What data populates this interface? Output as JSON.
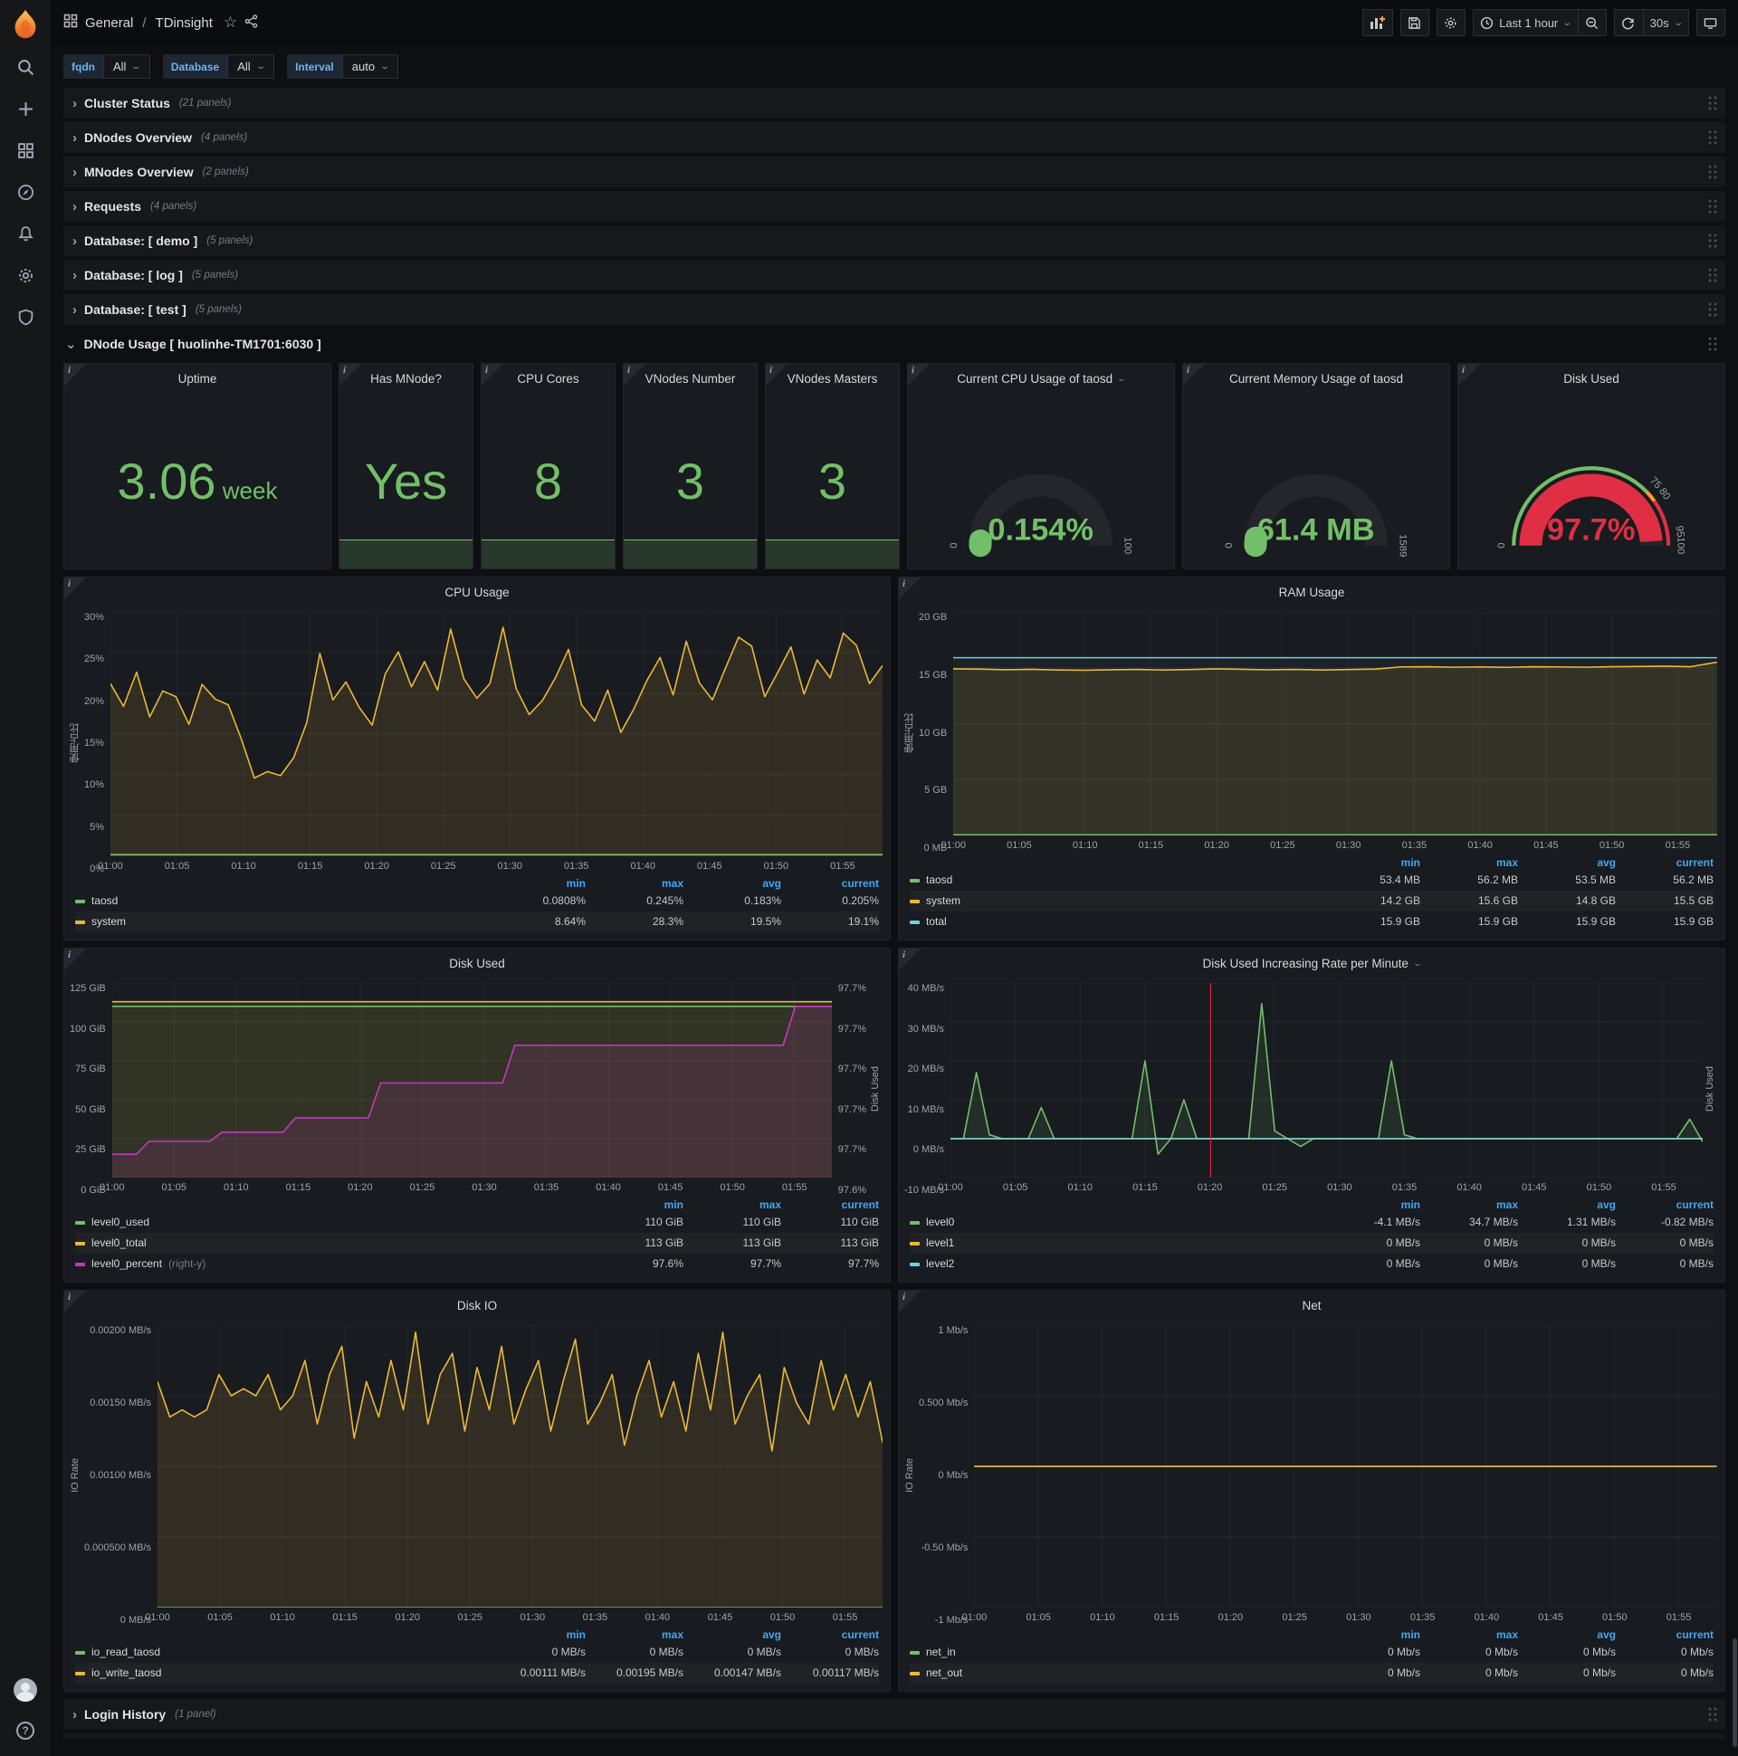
{
  "header": {
    "section": "General",
    "separator": "/",
    "title": "TDinsight"
  },
  "toolbar": {
    "time_range": "Last 1 hour",
    "refresh": "30s"
  },
  "variables": [
    {
      "label": "fqdn",
      "value": "All"
    },
    {
      "label": "Database",
      "value": "All"
    },
    {
      "label": "Interval",
      "value": "auto"
    }
  ],
  "collapsed_rows": [
    {
      "title": "Cluster Status",
      "count": "(21 panels)"
    },
    {
      "title": "DNodes Overview",
      "count": "(4 panels)"
    },
    {
      "title": "MNodes Overview",
      "count": "(2 panels)"
    },
    {
      "title": "Requests",
      "count": "(4 panels)"
    },
    {
      "title": "Database: [ demo ]",
      "count": "(5 panels)"
    },
    {
      "title": "Database: [ log ]",
      "count": "(5 panels)"
    },
    {
      "title": "Database: [ test ]",
      "count": "(5 panels)"
    }
  ],
  "expanded_row": {
    "title": "DNode Usage [ huolinhe-TM1701:6030 ]"
  },
  "login_row": {
    "title": "Login History",
    "count": "(1 panel)"
  },
  "stats": [
    {
      "title": "Uptime",
      "value": "3.06",
      "suffix": " week",
      "sparkline": false,
      "width": 2
    },
    {
      "title": "Has MNode?",
      "value": "Yes",
      "suffix": "",
      "sparkline": true,
      "width": 1
    },
    {
      "title": "CPU Cores",
      "value": "8",
      "suffix": "",
      "sparkline": true,
      "width": 1
    },
    {
      "title": "VNodes Number",
      "value": "3",
      "suffix": "",
      "sparkline": true,
      "width": 1
    },
    {
      "title": "VNodes Masters",
      "value": "3",
      "suffix": "",
      "sparkline": true,
      "width": 1
    }
  ],
  "gauges": [
    {
      "title": "Current CPU Usage of taosd",
      "dropdown": true,
      "value": "0.154%",
      "value_color": "#73bf69",
      "frac": 0.025,
      "arc_color": "#73bf69",
      "ticks": [
        {
          "f": 0,
          "label": "0"
        },
        {
          "f": 1,
          "label": "100"
        }
      ]
    },
    {
      "title": "Current Memory Usage of taosd",
      "dropdown": false,
      "value": "61.4 MB",
      "value_color": "#73bf69",
      "frac": 0.04,
      "arc_color": "#73bf69",
      "ticks": [
        {
          "f": 0,
          "label": "0"
        },
        {
          "f": 1,
          "label": "1589"
        }
      ]
    },
    {
      "title": "Disk Used",
      "dropdown": false,
      "value": "97.7%",
      "value_color": "#e02f44",
      "frac": 0.977,
      "arc_color": "#e02f44",
      "ticks": [
        {
          "f": 0,
          "label": "0"
        },
        {
          "f": 0.755,
          "label": "75"
        },
        {
          "f": 0.805,
          "label": "80"
        },
        {
          "f": 0.95,
          "label": "95"
        },
        {
          "f": 1,
          "label": "100"
        }
      ],
      "thresholds": [
        {
          "from": 0,
          "to": 0.755,
          "color": "#73bf69"
        },
        {
          "from": 0.755,
          "to": 0.805,
          "color": "#ff9830"
        },
        {
          "from": 0.805,
          "to": 1,
          "color": "#e02f44"
        }
      ]
    }
  ],
  "chart_data": [
    {
      "type": "line",
      "title": "CPU Usage",
      "dropdown": false,
      "ylabel": "使用占比",
      "right_label": null,
      "ylim": [
        0,
        30
      ],
      "y_ticks": [
        "0%",
        "5%",
        "10%",
        "15%",
        "20%",
        "25%",
        "30%"
      ],
      "x_ticks": [
        "01:00",
        "01:05",
        "01:10",
        "01:15",
        "01:20",
        "01:25",
        "01:30",
        "01:35",
        "01:40",
        "01:45",
        "01:50",
        "01:55"
      ],
      "x_total_minutes": 58,
      "series": [
        {
          "name": "system",
          "color": "#eab839",
          "fill": 0.12,
          "values": [
            21.2,
            18.4,
            22.6,
            17.1,
            20.3,
            19.6,
            16.2,
            21.1,
            19.3,
            18.6,
            14.4,
            9.6,
            10.4,
            9.9,
            12.1,
            16.4,
            24.9,
            19.2,
            21.4,
            18.3,
            16.1,
            22.4,
            25.1,
            20.8,
            23.9,
            20.4,
            27.9,
            21.8,
            19.4,
            21.2,
            28.1,
            20.6,
            17.4,
            19.1,
            21.9,
            25.4,
            18.6,
            16.6,
            20.4,
            15.2,
            18.1,
            21.6,
            24.4,
            19.8,
            26.4,
            21.3,
            19.2,
            23.1,
            26.9,
            25.8,
            19.6,
            22.6,
            25.7,
            19.9,
            24.1,
            21.9,
            27.4,
            25.9,
            21.2,
            23.4
          ]
        },
        {
          "name": "taosd",
          "color": "#73bf69",
          "fill": 0.1,
          "values": [
            0.2,
            0.2
          ]
        }
      ],
      "legend": {
        "headers": [
          "min",
          "max",
          "avg",
          "current"
        ],
        "rows": [
          {
            "name": "taosd",
            "suffix": "",
            "color": "#73bf69",
            "values": [
              "0.0808%",
              "0.245%",
              "0.183%",
              "0.205%"
            ]
          },
          {
            "name": "system",
            "suffix": "",
            "color": "#eab839",
            "values": [
              "8.64%",
              "28.3%",
              "19.5%",
              "19.1%"
            ]
          }
        ]
      }
    },
    {
      "type": "line",
      "title": "RAM Usage",
      "dropdown": false,
      "ylabel": "使用占比",
      "right_label": null,
      "ylim": [
        0,
        20
      ],
      "y_ticks": [
        "0 MB",
        "5 GB",
        "10 GB",
        "15 GB",
        "20 GB"
      ],
      "x_ticks": [
        "01:00",
        "01:05",
        "01:10",
        "01:15",
        "01:20",
        "01:25",
        "01:30",
        "01:35",
        "01:40",
        "01:45",
        "01:50",
        "01:55"
      ],
      "x_total_minutes": 58,
      "series": [
        {
          "name": "total",
          "color": "#6ed0e0",
          "fill": 0.04,
          "values": [
            15.9,
            15.9
          ]
        },
        {
          "name": "system",
          "color": "#eab839",
          "fill": 0.12,
          "values": [
            14.9,
            14.88,
            14.82,
            14.86,
            14.8,
            14.78,
            14.82,
            14.85,
            14.8,
            14.84,
            14.9,
            14.86,
            14.82,
            14.85,
            14.8,
            14.84,
            14.88,
            15.08,
            15.1,
            15.05,
            15.08,
            15.04,
            15.1,
            15.08,
            15.05,
            15.1,
            15.12,
            15.15,
            15.1,
            15.5
          ]
        },
        {
          "name": "taosd",
          "color": "#73bf69",
          "fill": 0.1,
          "values": [
            0.055,
            0.055
          ]
        }
      ],
      "legend": {
        "headers": [
          "min",
          "max",
          "avg",
          "current"
        ],
        "rows": [
          {
            "name": "taosd",
            "suffix": "",
            "color": "#73bf69",
            "values": [
              "53.4 MB",
              "56.2 MB",
              "53.5 MB",
              "56.2 MB"
            ]
          },
          {
            "name": "system",
            "suffix": "",
            "color": "#eab839",
            "values": [
              "14.2 GB",
              "15.6 GB",
              "14.8 GB",
              "15.5 GB"
            ]
          },
          {
            "name": "total",
            "suffix": "",
            "color": "#6ed0e0",
            "values": [
              "15.9 GB",
              "15.9 GB",
              "15.9 GB",
              "15.9 GB"
            ]
          }
        ]
      }
    },
    {
      "type": "line",
      "title": "Disk Used",
      "dropdown": false,
      "ylabel": null,
      "right_label": "Disk Used",
      "ylim": [
        0,
        125
      ],
      "y_ticks": [
        "0 GiB",
        "25 GiB",
        "50 GiB",
        "75 GiB",
        "100 GiB",
        "125 GiB"
      ],
      "right_lim": [
        97.58,
        97.73
      ],
      "right_ticks": [
        "97.6%",
        "97.7%",
        "97.7%",
        "97.7%",
        "97.7%",
        "97.7%"
      ],
      "x_ticks": [
        "01:00",
        "01:05",
        "01:10",
        "01:15",
        "01:20",
        "01:25",
        "01:30",
        "01:35",
        "01:40",
        "01:45",
        "01:50",
        "01:55"
      ],
      "x_total_minutes": 58,
      "series": [
        {
          "name": "level0_total",
          "color": "#eab839",
          "fill": 0.1,
          "values": [
            113,
            113
          ]
        },
        {
          "name": "level0_used",
          "color": "#73bf69",
          "fill": 0.06,
          "values": [
            110,
            110
          ]
        },
        {
          "name": "level0_percent",
          "color": "#c438bd",
          "fill": 0.14,
          "axis": "right",
          "values": [
            97.598,
            97.598,
            97.598,
            97.608,
            97.608,
            97.608,
            97.608,
            97.608,
            97.608,
            97.615,
            97.615,
            97.615,
            97.615,
            97.615,
            97.615,
            97.626,
            97.626,
            97.626,
            97.626,
            97.626,
            97.626,
            97.626,
            97.653,
            97.653,
            97.653,
            97.653,
            97.653,
            97.653,
            97.653,
            97.653,
            97.653,
            97.653,
            97.653,
            97.682,
            97.682,
            97.682,
            97.682,
            97.682,
            97.682,
            97.682,
            97.682,
            97.682,
            97.682,
            97.682,
            97.682,
            97.682,
            97.682,
            97.682,
            97.682,
            97.682,
            97.682,
            97.682,
            97.682,
            97.682,
            97.682,
            97.682,
            97.712,
            97.712,
            97.712,
            97.712
          ]
        }
      ],
      "legend": {
        "headers": [
          "min",
          "max",
          "current"
        ],
        "rows": [
          {
            "name": "level0_used",
            "suffix": "",
            "color": "#73bf69",
            "values": [
              "110 GiB",
              "110 GiB",
              "110 GiB"
            ]
          },
          {
            "name": "level0_total",
            "suffix": "",
            "color": "#eab839",
            "values": [
              "113 GiB",
              "113 GiB",
              "113 GiB"
            ]
          },
          {
            "name": "level0_percent",
            "suffix": " (right-y)",
            "color": "#c438bd",
            "values": [
              "97.6%",
              "97.7%",
              "97.7%"
            ]
          }
        ]
      }
    },
    {
      "type": "line",
      "title": "Disk Used Increasing Rate per Minute",
      "dropdown": true,
      "ylabel": null,
      "right_label": "Disk Used",
      "ylim": [
        -10,
        40
      ],
      "y_ticks": [
        "-10 MB/s",
        "0 MB/s",
        "10 MB/s",
        "20 MB/s",
        "30 MB/s",
        "40 MB/s"
      ],
      "x_ticks": [
        "01:00",
        "01:05",
        "01:10",
        "01:15",
        "01:20",
        "01:25",
        "01:30",
        "01:35",
        "01:40",
        "01:45",
        "01:50",
        "01:55"
      ],
      "x_total_minutes": 58,
      "annotation": {
        "time": "01:20",
        "frac": 0.345,
        "color": "#eb2032"
      },
      "series": [
        {
          "name": "level0",
          "color": "#73bf69",
          "fill": 0.12,
          "values": [
            0,
            0,
            17,
            1,
            0,
            0,
            0,
            8,
            0,
            0,
            0,
            0,
            0,
            0,
            0,
            20,
            -4,
            0,
            10,
            0,
            0,
            0,
            0,
            0,
            34.7,
            2,
            0,
            -2,
            0,
            0,
            0,
            0,
            0,
            0,
            20,
            1,
            0,
            0,
            0,
            0,
            0,
            0,
            0,
            0,
            0,
            0,
            0,
            0,
            0,
            0,
            0,
            0,
            0,
            0,
            0,
            0,
            0,
            5,
            -0.82
          ]
        },
        {
          "name": "level1",
          "color": "#eab839",
          "fill": 0,
          "values": [
            0,
            0
          ]
        },
        {
          "name": "level2",
          "color": "#6ed0e0",
          "fill": 0,
          "values": [
            0,
            0
          ]
        }
      ],
      "legend": {
        "headers": [
          "min",
          "max",
          "avg",
          "current"
        ],
        "rows": [
          {
            "name": "level0",
            "suffix": "",
            "color": "#73bf69",
            "values": [
              "-4.1 MB/s",
              "34.7 MB/s",
              "1.31 MB/s",
              "-0.82 MB/s"
            ]
          },
          {
            "name": "level1",
            "suffix": "",
            "color": "#eab839",
            "values": [
              "0 MB/s",
              "0 MB/s",
              "0 MB/s",
              "0 MB/s"
            ]
          },
          {
            "name": "level2",
            "suffix": "",
            "color": "#6ed0e0",
            "values": [
              "0 MB/s",
              "0 MB/s",
              "0 MB/s",
              "0 MB/s"
            ]
          }
        ]
      }
    },
    {
      "type": "line",
      "title": "Disk IO",
      "dropdown": false,
      "ylabel": "IO Rate",
      "right_label": null,
      "ylim": [
        0,
        0.002
      ],
      "y_ticks": [
        "0 MB/s",
        "0.000500 MB/s",
        "0.00100 MB/s",
        "0.00150 MB/s",
        "0.00200 MB/s"
      ],
      "x_ticks": [
        "01:00",
        "01:05",
        "01:10",
        "01:15",
        "01:20",
        "01:25",
        "01:30",
        "01:35",
        "01:40",
        "01:45",
        "01:50",
        "01:55"
      ],
      "x_total_minutes": 58,
      "series": [
        {
          "name": "io_write_taosd",
          "color": "#eab839",
          "fill": 0.12,
          "values": [
            0.0016,
            0.00135,
            0.0014,
            0.00135,
            0.0014,
            0.00165,
            0.0015,
            0.00155,
            0.0015,
            0.00165,
            0.0014,
            0.0015,
            0.00175,
            0.0013,
            0.00165,
            0.00185,
            0.0012,
            0.0016,
            0.00135,
            0.00175,
            0.0014,
            0.00195,
            0.0013,
            0.00165,
            0.0018,
            0.00125,
            0.0017,
            0.0014,
            0.00185,
            0.0013,
            0.00155,
            0.00175,
            0.00125,
            0.0016,
            0.0019,
            0.0013,
            0.00145,
            0.00165,
            0.00115,
            0.0015,
            0.00175,
            0.00135,
            0.0016,
            0.00125,
            0.0018,
            0.0014,
            0.00195,
            0.0013,
            0.0015,
            0.00165,
            0.00111,
            0.0017,
            0.00145,
            0.0013,
            0.00175,
            0.0014,
            0.00165,
            0.00135,
            0.0016,
            0.00117
          ]
        },
        {
          "name": "io_read_taosd",
          "color": "#73bf69",
          "fill": 0,
          "values": [
            0,
            0
          ]
        }
      ],
      "legend": {
        "headers": [
          "min",
          "max",
          "avg",
          "current"
        ],
        "rows": [
          {
            "name": "io_read_taosd",
            "suffix": "",
            "color": "#73bf69",
            "values": [
              "0 MB/s",
              "0 MB/s",
              "0 MB/s",
              "0 MB/s"
            ]
          },
          {
            "name": "io_write_taosd",
            "suffix": "",
            "color": "#eab839",
            "values": [
              "0.00111 MB/s",
              "0.00195 MB/s",
              "0.00147 MB/s",
              "0.00117 MB/s"
            ]
          }
        ]
      }
    },
    {
      "type": "line",
      "title": "Net",
      "dropdown": false,
      "ylabel": "IO Rate",
      "right_label": null,
      "ylim": [
        -1,
        1
      ],
      "y_ticks": [
        "-1 Mb/s",
        "-0.50 Mb/s",
        "0 Mb/s",
        "0.500 Mb/s",
        "1 Mb/s"
      ],
      "x_ticks": [
        "01:00",
        "01:05",
        "01:10",
        "01:15",
        "01:20",
        "01:25",
        "01:30",
        "01:35",
        "01:40",
        "01:45",
        "01:50",
        "01:55"
      ],
      "x_total_minutes": 58,
      "series": [
        {
          "name": "net_in",
          "color": "#73bf69",
          "fill": 0,
          "values": [
            0,
            0
          ]
        },
        {
          "name": "net_out",
          "color": "#eab839",
          "fill": 0,
          "values": [
            0,
            0
          ]
        }
      ],
      "legend": {
        "headers": [
          "min",
          "max",
          "avg",
          "current"
        ],
        "rows": [
          {
            "name": "net_in",
            "suffix": "",
            "color": "#73bf69",
            "values": [
              "0 Mb/s",
              "0 Mb/s",
              "0 Mb/s",
              "0 Mb/s"
            ]
          },
          {
            "name": "net_out",
            "suffix": "",
            "color": "#eab839",
            "values": [
              "0 Mb/s",
              "0 Mb/s",
              "0 Mb/s",
              "0 Mb/s"
            ]
          }
        ]
      }
    }
  ]
}
